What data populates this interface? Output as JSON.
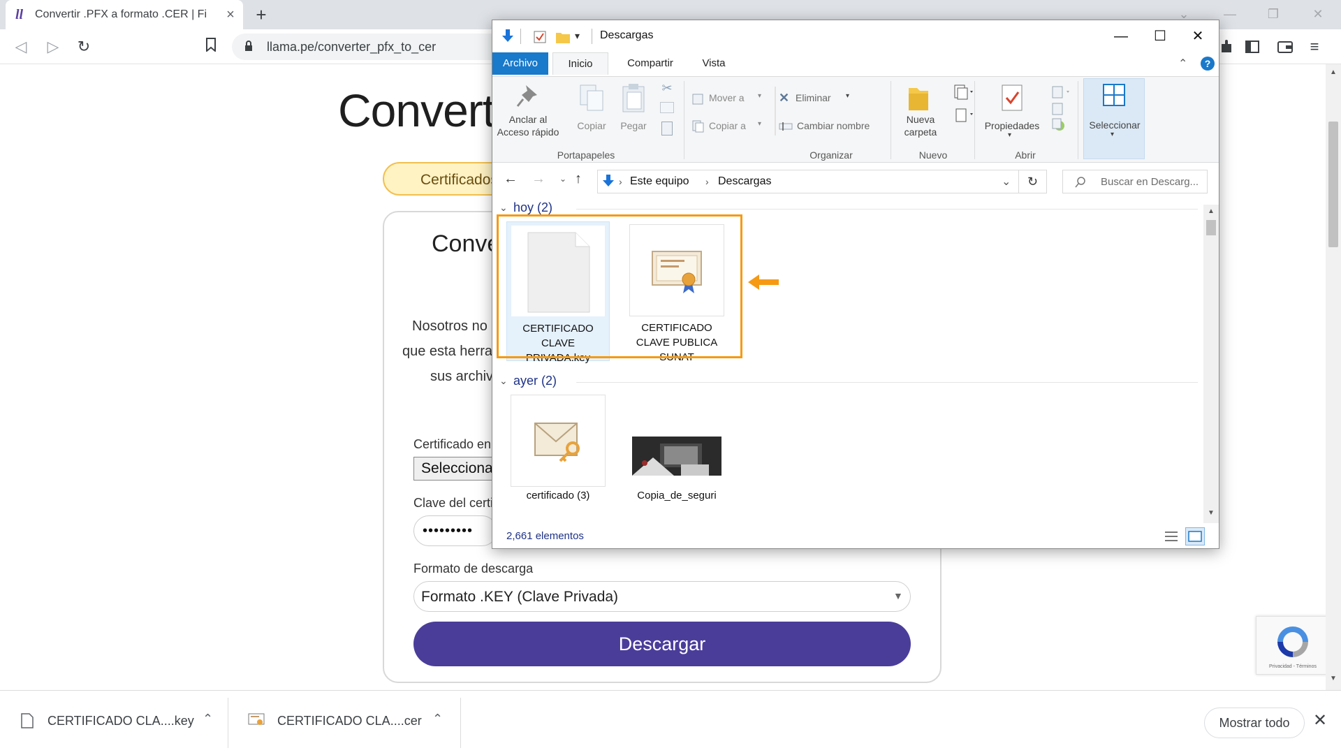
{
  "browser": {
    "tab_title": "Convertir .PFX a formato .CER | Fi",
    "url": "llama.pe/converter_pfx_to_cer"
  },
  "page": {
    "heading": "Converti",
    "pill_label": "Certificados",
    "card_title": "Conve",
    "intro_lines": [
      "Nosotros no a",
      "que esta herran",
      "sus archivo"
    ],
    "file_label": "Certificado en f",
    "file_select_value": "Seleccionar",
    "password_label": "Clave del certifi",
    "password_value": "•••••••••",
    "format_label": "Formato de descarga",
    "format_value": "Formato .KEY (Clave Privada)",
    "download_button": "Descargar",
    "recaptcha_text": "Privacidad - Términos"
  },
  "explorer": {
    "title": "Descargas",
    "tabs": [
      "Archivo",
      "Inicio",
      "Compartir",
      "Vista"
    ],
    "ribbon": {
      "pin": "Anclar al\nAcceso rápido",
      "copy": "Copiar",
      "paste": "Pegar",
      "move_to": "Mover a",
      "copy_to": "Copiar a",
      "delete": "Eliminar",
      "rename": "Cambiar nombre",
      "new_folder": "Nueva\ncarpeta",
      "properties": "Propiedades",
      "select": "Seleccionar",
      "groups": [
        "Portapapeles",
        "Organizar",
        "Nuevo",
        "Abrir"
      ]
    },
    "breadcrumb": [
      "Este equipo",
      "Descargas"
    ],
    "search_placeholder": "Buscar en Descarg...",
    "groups": [
      {
        "header": "hoy (2)",
        "files": [
          {
            "name": "CERTIFICADO\nCLAVE\nPRIVADA.key",
            "icon": "blank-file-icon"
          },
          {
            "name": "CERTIFICADO\nCLAVE PUBLICA\nSUNAT",
            "icon": "certificate-icon"
          }
        ]
      },
      {
        "header": "ayer (2)",
        "files": [
          {
            "name": "certificado (3)",
            "icon": "key-envelope-icon"
          },
          {
            "name": "Copia_de_seguri",
            "icon": "photo-thumbnail"
          }
        ]
      }
    ],
    "status": "2,661 elementos"
  },
  "downloads": {
    "items": [
      "CERTIFICADO CLA....key",
      "CERTIFICADO CLA....cer"
    ],
    "show_all": "Mostrar todo"
  },
  "colors": {
    "accent_purple": "#4a3d9a",
    "highlight_orange": "#f59a12",
    "explorer_blue": "#1979ca"
  }
}
